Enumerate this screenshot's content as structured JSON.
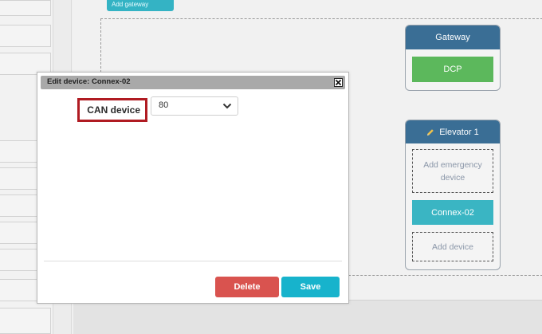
{
  "toolbar": {
    "add_gateway_label": "Add gateway"
  },
  "gateway": {
    "title": "Gateway",
    "device_label": "DCP"
  },
  "elevator": {
    "title": "Elevator 1",
    "add_emergency_label": "Add emergency device",
    "device_label": "Connex-02",
    "add_device_label": "Add device"
  },
  "dialog": {
    "title": "Edit device: Connex-02",
    "field_label": "CAN device",
    "field_value": "80",
    "delete_label": "Delete",
    "save_label": "Save"
  },
  "colors": {
    "card_header": "#3a6e95",
    "dcp_green": "#5cb85c",
    "connex_teal": "#3ab5c3",
    "delete_red": "#d9534f",
    "save_teal": "#17b3cc",
    "highlight_red": "#b01b22"
  }
}
